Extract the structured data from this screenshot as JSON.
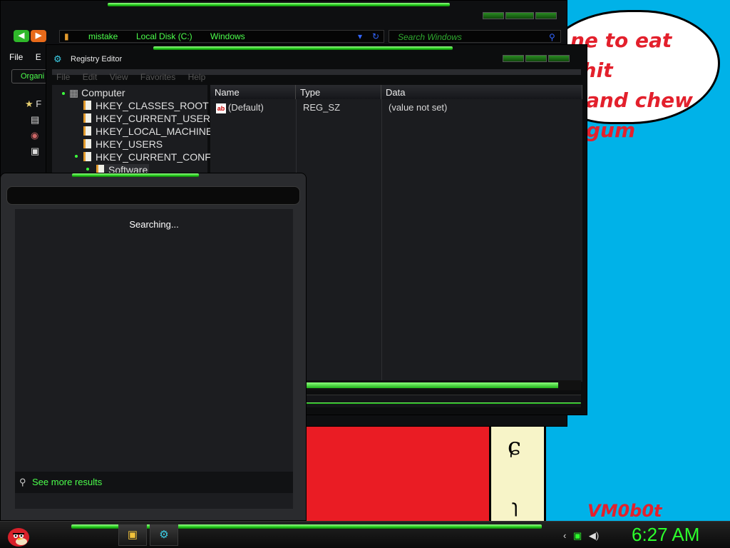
{
  "wallpaper": {
    "bubble_lines": [
      "ne to eat shit",
      "and chew",
      "gum"
    ],
    "signature": "VM0b0t"
  },
  "explorer": {
    "breadcrumb": [
      "mistake",
      "Local Disk (C:)",
      "Windows"
    ],
    "search_placeholder": "Search Windows",
    "menu": [
      "File",
      "E"
    ],
    "organize_label": "Organi",
    "favorites_label": "F"
  },
  "regedit": {
    "title": "Registry Editor",
    "menu": [
      "File",
      "Edit",
      "View",
      "Favorites",
      "Help"
    ],
    "tree": {
      "root": "Computer",
      "keys": [
        "HKEY_CLASSES_ROOT",
        "HKEY_CURRENT_USER",
        "HKEY_LOCAL_MACHINE",
        "HKEY_USERS",
        "HKEY_CURRENT_CONFI"
      ],
      "selected": "Software"
    },
    "columns": [
      "Name",
      "Type",
      "Data"
    ],
    "rows": [
      {
        "name": "(Default)",
        "type": "REG_SZ",
        "data": "(value not set)"
      }
    ]
  },
  "search_panel": {
    "status": "Searching...",
    "more_link": "See more results"
  },
  "taskbar": {
    "clock": "6:27 AM"
  }
}
